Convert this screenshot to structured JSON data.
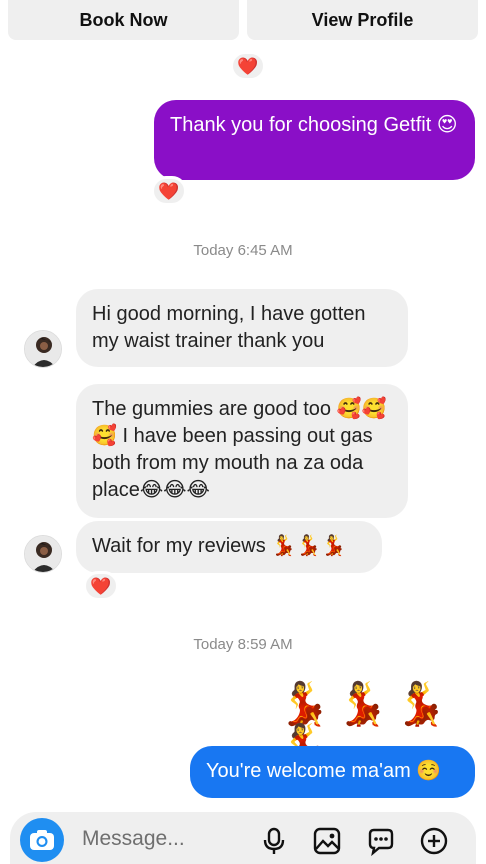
{
  "profile_actions": {
    "book_label": "Book Now",
    "view_label": "View Profile"
  },
  "messages": [
    {
      "side": "sent",
      "text": "Thank you for choosing Getfit 😍",
      "reaction": "❤️"
    },
    {
      "side": "received",
      "text": "Hi good morning, I have gotten my waist trainer thank you"
    },
    {
      "side": "received",
      "text": "The gummies are good too 🥰🥰🥰 I have been passing out gas both from my mouth na za oda place😂😂😂"
    },
    {
      "side": "received",
      "text": "Wait for my reviews 💃💃💃",
      "reaction": "❤️"
    },
    {
      "side": "sent",
      "text": "💃💃💃💃"
    },
    {
      "side": "sent",
      "text": "You're welcome ma'am ☺️"
    }
  ],
  "timestamps": [
    "Today 6:45 AM",
    "Today 8:59 AM"
  ],
  "top_reaction": "❤️",
  "composer": {
    "placeholder": "Message...",
    "icons": [
      "camera-icon",
      "microphone-icon",
      "gallery-icon",
      "sticker-icon",
      "add-icon"
    ]
  },
  "colors": {
    "sent_purple": "#8a0fc7",
    "sent_blue": "#1877f2",
    "received_gray": "#efefef",
    "heart": "#ed2b3c",
    "camera_blue": "#1f8ef1"
  }
}
